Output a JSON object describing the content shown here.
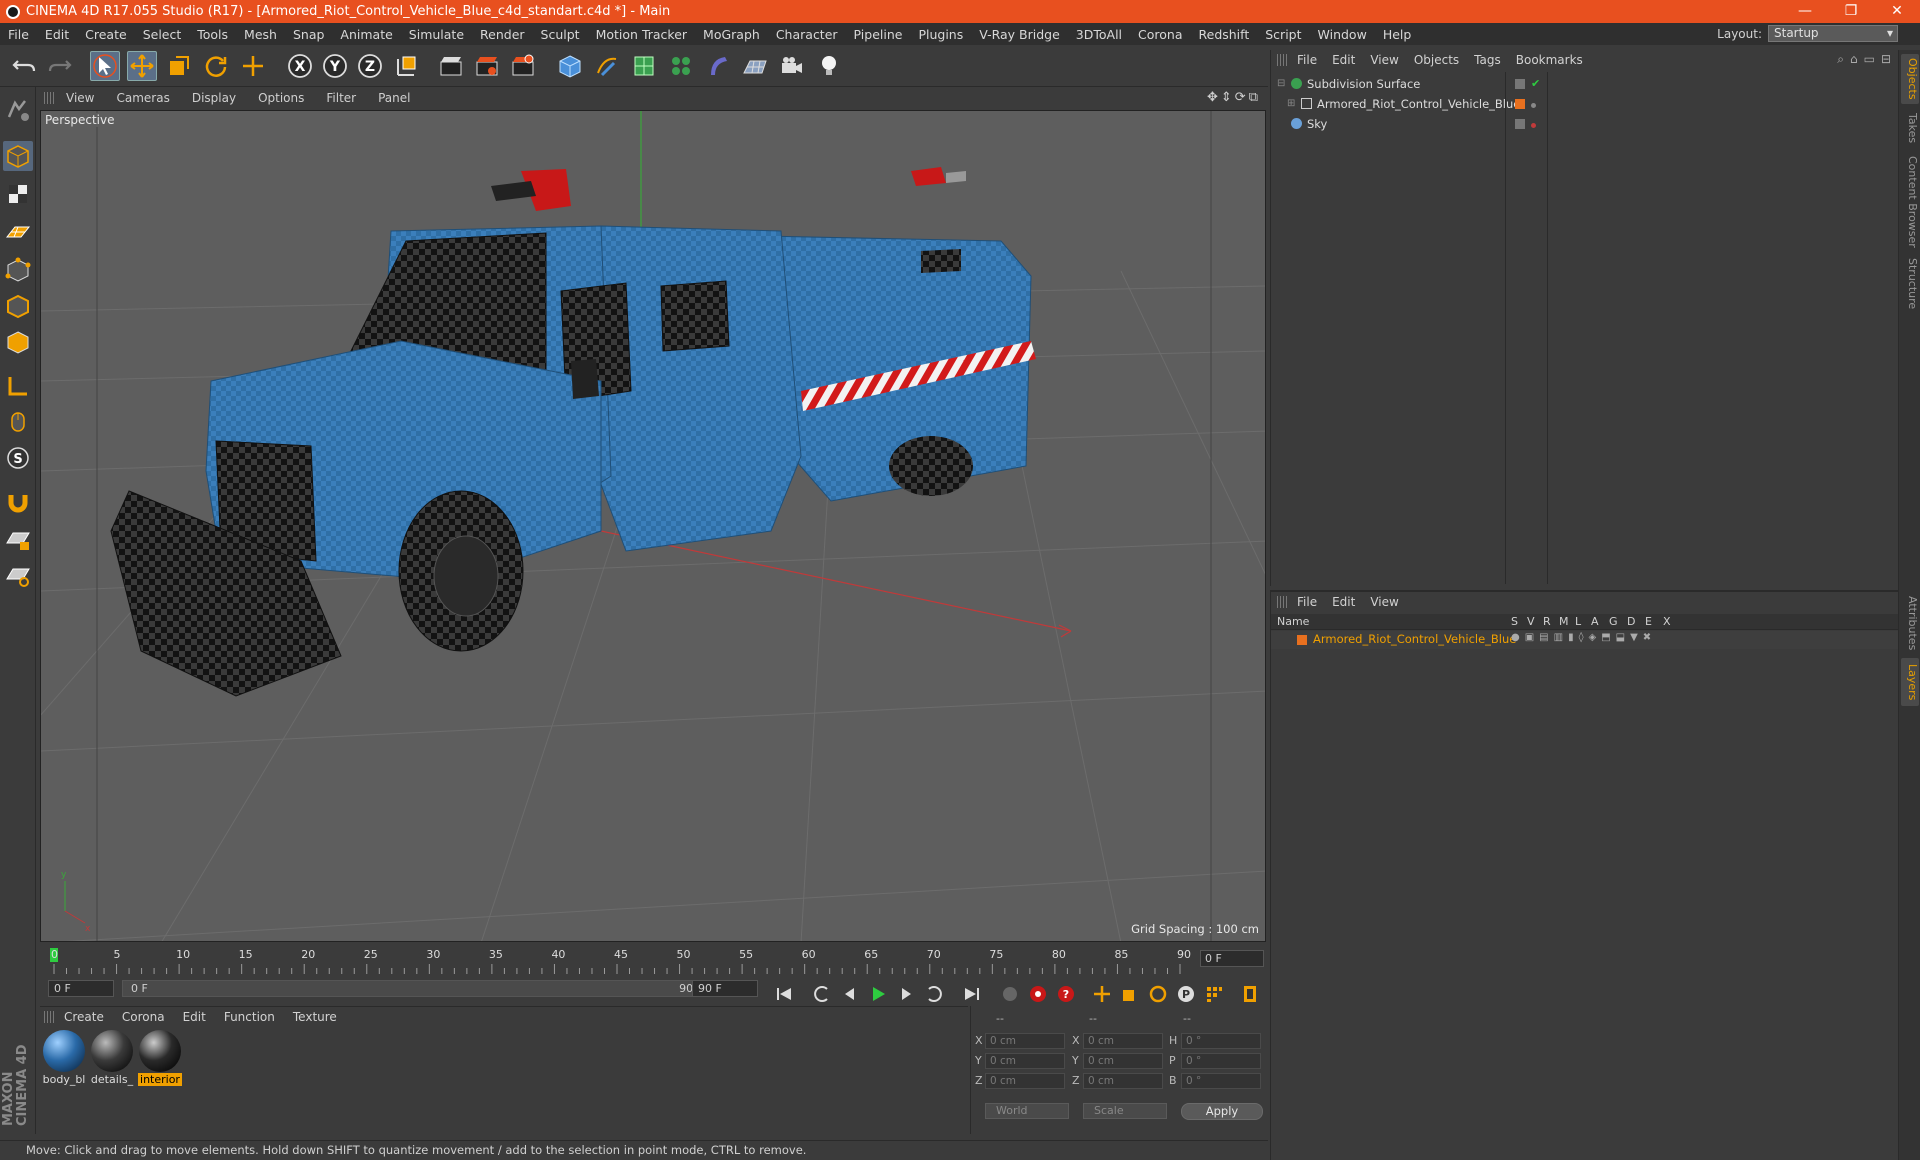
{
  "window": {
    "title": "CINEMA 4D R17.055 Studio (R17) - [Armored_Riot_Control_Vehicle_Blue_c4d_standart.c4d *] - Main",
    "buttons": [
      "—",
      "❐",
      "✕"
    ]
  },
  "menu": [
    "File",
    "Edit",
    "Create",
    "Select",
    "Tools",
    "Mesh",
    "Snap",
    "Animate",
    "Simulate",
    "Render",
    "Sculpt",
    "Motion Tracker",
    "MoGraph",
    "Character",
    "Pipeline",
    "Plugins",
    "V-Ray Bridge",
    "3DToAll",
    "Corona",
    "Redshift",
    "Script",
    "Window",
    "Help"
  ],
  "layout": {
    "label": "Layout:",
    "value": "Startup"
  },
  "viewport": {
    "menu": [
      "View",
      "Cameras",
      "Display",
      "Options",
      "Filter",
      "Panel"
    ],
    "name": "Perspective",
    "grid_spacing": "Grid Spacing : 100 cm"
  },
  "timeline": {
    "ticks": [
      "0",
      "5",
      "10",
      "15",
      "20",
      "25",
      "30",
      "35",
      "40",
      "45",
      "50",
      "55",
      "60",
      "65",
      "70",
      "75",
      "80",
      "85",
      "90"
    ],
    "current_frame": "0 F",
    "start_frame": "0 F",
    "range_start": "0 F",
    "range_end": "90 F",
    "end_frame": "90 F"
  },
  "materials": {
    "menu": [
      "Create",
      "Corona",
      "Edit",
      "Function",
      "Texture"
    ],
    "items": [
      {
        "label": "body_bl",
        "color": "#2a6aa8",
        "selected": false
      },
      {
        "label": "details_",
        "color": "#3a3a3a",
        "selected": false
      },
      {
        "label": "interior",
        "color": "#2a2a2a",
        "selected": true
      }
    ]
  },
  "coordinates": {
    "header": [
      "--",
      "--",
      "--"
    ],
    "rows": [
      {
        "a": "X",
        "av": "0 cm",
        "b": "X",
        "bv": "0 cm",
        "c": "H",
        "cv": "0 °"
      },
      {
        "a": "Y",
        "av": "0 cm",
        "b": "Y",
        "bv": "0 cm",
        "c": "P",
        "cv": "0 °"
      },
      {
        "a": "Z",
        "av": "0 cm",
        "b": "Z",
        "bv": "0 cm",
        "c": "B",
        "cv": "0 °"
      }
    ],
    "mode_world": "World",
    "mode_scale": "Scale",
    "apply": "Apply"
  },
  "objects": {
    "menu": [
      "File",
      "Edit",
      "View",
      "Objects",
      "Tags",
      "Bookmarks"
    ],
    "items": [
      {
        "name": "Subdivision Surface"
      },
      {
        "name": "Armored_Riot_Control_Vehicle_Blue"
      },
      {
        "name": "Sky"
      }
    ]
  },
  "layers": {
    "menu": [
      "File",
      "Edit",
      "View"
    ],
    "columns": [
      "Name",
      "S",
      "V",
      "R",
      "M",
      "L",
      "A",
      "G",
      "D",
      "E",
      "X"
    ],
    "row_name": "Armored_Riot_Control_Vehicle_Blue"
  },
  "side_tabs": [
    "Objects",
    "Takes",
    "Content Browser",
    "Structure",
    "Attributes",
    "Layers"
  ],
  "status": "Move: Click and drag to move elements. Hold down SHIFT to quantize movement / add to the selection in point mode, CTRL to remove.",
  "logo": {
    "line1": "MAXON",
    "line2": "CINEMA 4D"
  },
  "colors": {
    "accent": "#e8501f",
    "selection": "#f0a000",
    "viewport_bg": "#5e5e5e"
  }
}
